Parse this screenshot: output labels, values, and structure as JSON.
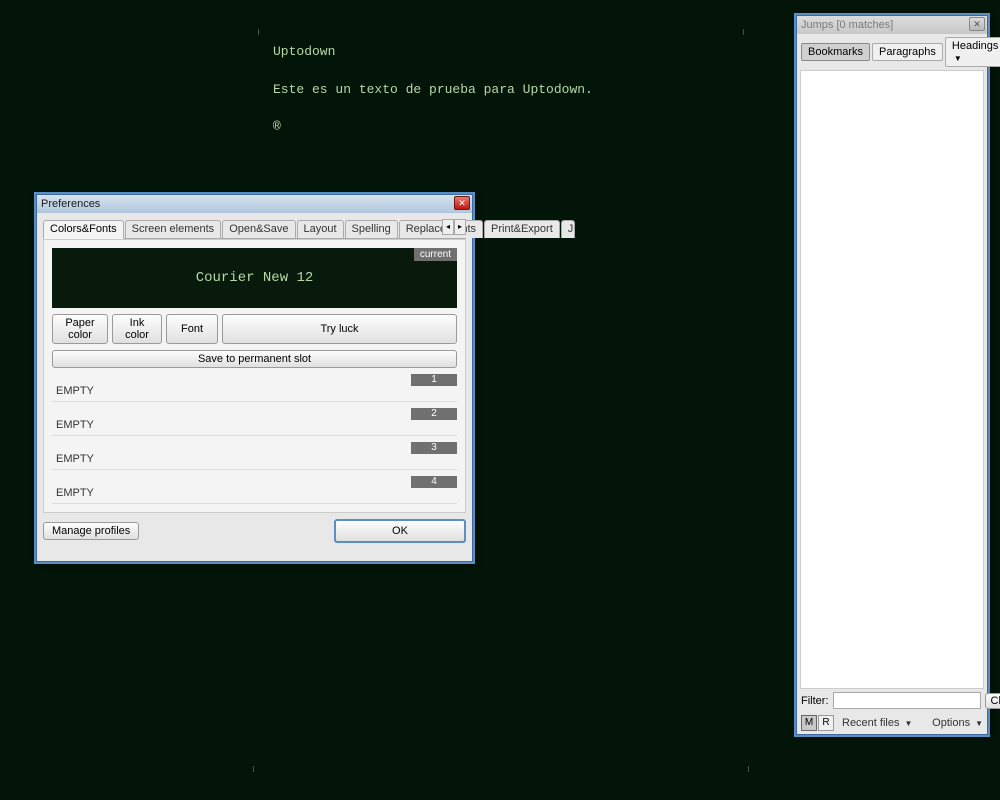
{
  "editor": {
    "line1": "Uptodown",
    "line2": "Este es un texto de prueba para Uptodown.",
    "symbol": "®"
  },
  "prefs": {
    "title": "Preferences",
    "tabs": [
      "Colors&Fonts",
      "Screen elements",
      "Open&Save",
      "Layout",
      "Spelling",
      "Replacements",
      "Print&Export",
      "Jump"
    ],
    "active_tab": 0,
    "preview_badge": "current",
    "preview_font": "Courier New 12",
    "btn_paper": "Paper color",
    "btn_ink": "Ink color",
    "btn_font": "Font",
    "btn_tryluck": "Try luck",
    "btn_save_slot": "Save to permanent slot",
    "slots": [
      {
        "label": "EMPTY",
        "num": "1"
      },
      {
        "label": "EMPTY",
        "num": "2"
      },
      {
        "label": "EMPTY",
        "num": "3"
      },
      {
        "label": "EMPTY",
        "num": "4"
      }
    ],
    "btn_manage": "Manage profiles",
    "btn_ok": "OK"
  },
  "jumps": {
    "title": "Jumps [0 matches]",
    "segments": [
      "Bookmarks",
      "Paragraphs",
      "Headings"
    ],
    "active_segment": 0,
    "filter_label": "Filter:",
    "btn_clear": "Clear",
    "toggle_m": "M",
    "toggle_r": "R",
    "recent_label": "Recent files",
    "options_label": "Options"
  }
}
